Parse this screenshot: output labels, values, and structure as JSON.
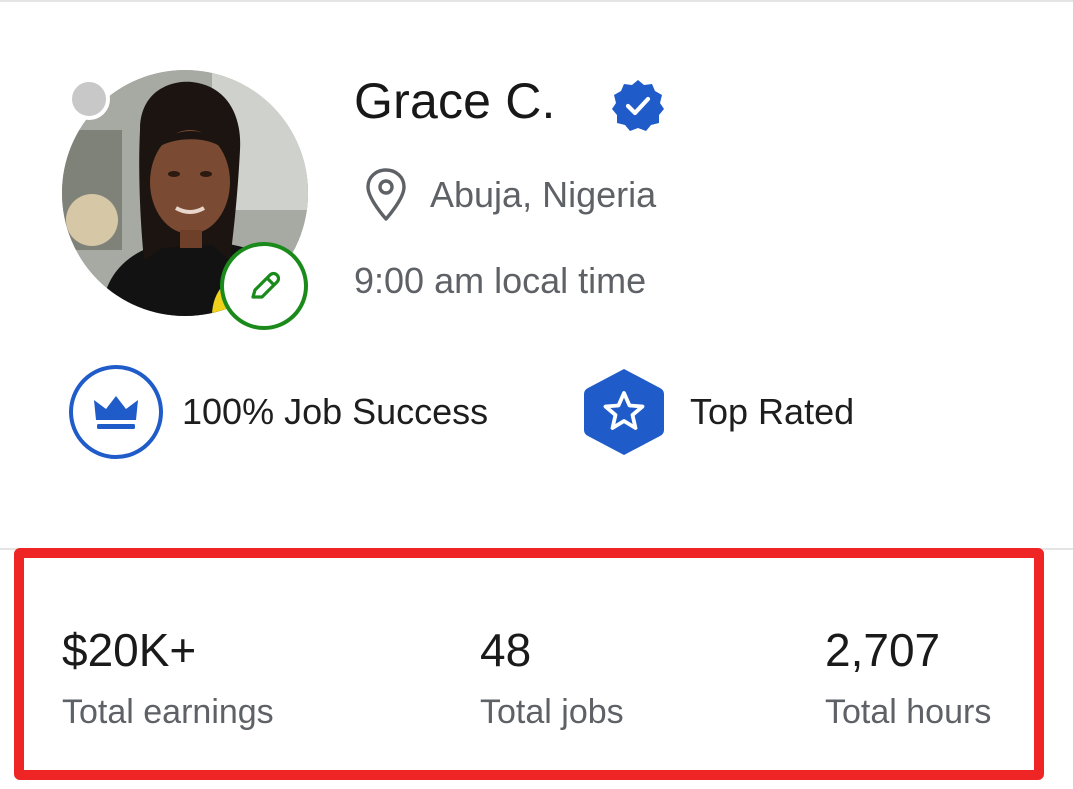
{
  "profile": {
    "name": "Grace C.",
    "location": "Abuja, Nigeria",
    "local_time": "9:00 am local time",
    "online_status": "offline"
  },
  "badges": [
    {
      "label": "100% Job Success",
      "icon": "crown-icon"
    },
    {
      "label": "Top Rated",
      "icon": "star-badge-icon"
    }
  ],
  "stats": [
    {
      "value": "$20K+",
      "label": "Total earnings"
    },
    {
      "value": "48",
      "label": "Total jobs"
    },
    {
      "value": "2,707",
      "label": "Total hours"
    }
  ],
  "colors": {
    "brand_blue": "#1f5bc9",
    "edit_green": "#1a8a1a",
    "highlight_red": "#ef2424",
    "muted_text": "#5e6166"
  }
}
